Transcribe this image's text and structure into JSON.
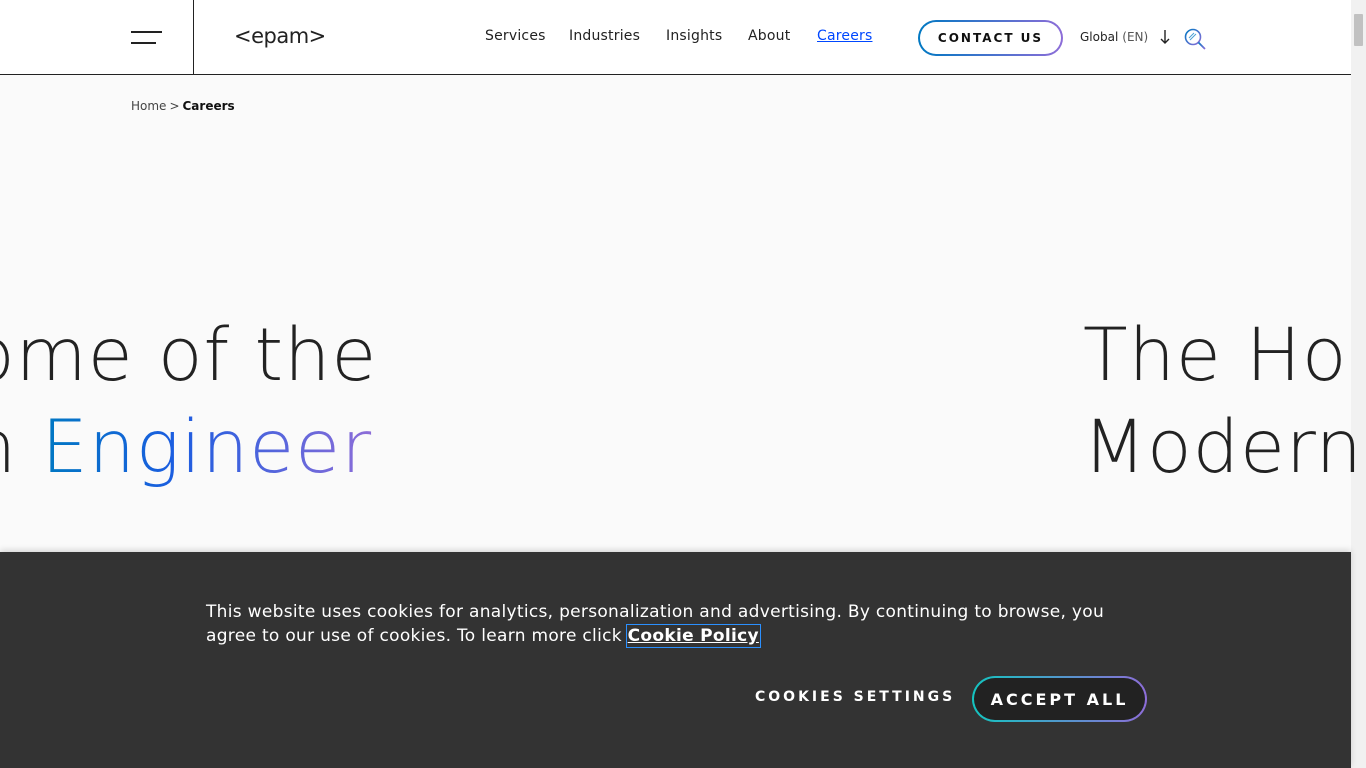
{
  "header": {
    "logo_text": "<epam>",
    "nav": [
      {
        "label": "Services"
      },
      {
        "label": "Industries"
      },
      {
        "label": "Insights"
      },
      {
        "label": "About"
      },
      {
        "label": "Careers",
        "active": true
      }
    ],
    "contact_label": "CONTACT US",
    "lang_label": "Global",
    "lang_code": "(EN)",
    "search_icon": "search-icon"
  },
  "breadcrumb": {
    "home": "Home",
    "separator": ">",
    "current": "Careers"
  },
  "hero": {
    "left_line1": "ome of the",
    "left_line2_prefix": "n",
    "left_line2_gradient": "Engineer",
    "right_line1": "The Ho",
    "right_line2": "Modern"
  },
  "cookie_banner": {
    "text": "This website uses cookies for analytics, personalization and advertising. By continuing to browse, you agree to our use of cookies. To learn more click ",
    "link_label": "Cookie Policy",
    "settings_label": "COOKIES SETTINGS",
    "accept_label": "ACCEPT ALL"
  },
  "colors": {
    "accent_blue": "#0078c2",
    "accent_purple": "#8d6dd8",
    "active_link": "#0047ff",
    "banner_bg": "#333333"
  }
}
